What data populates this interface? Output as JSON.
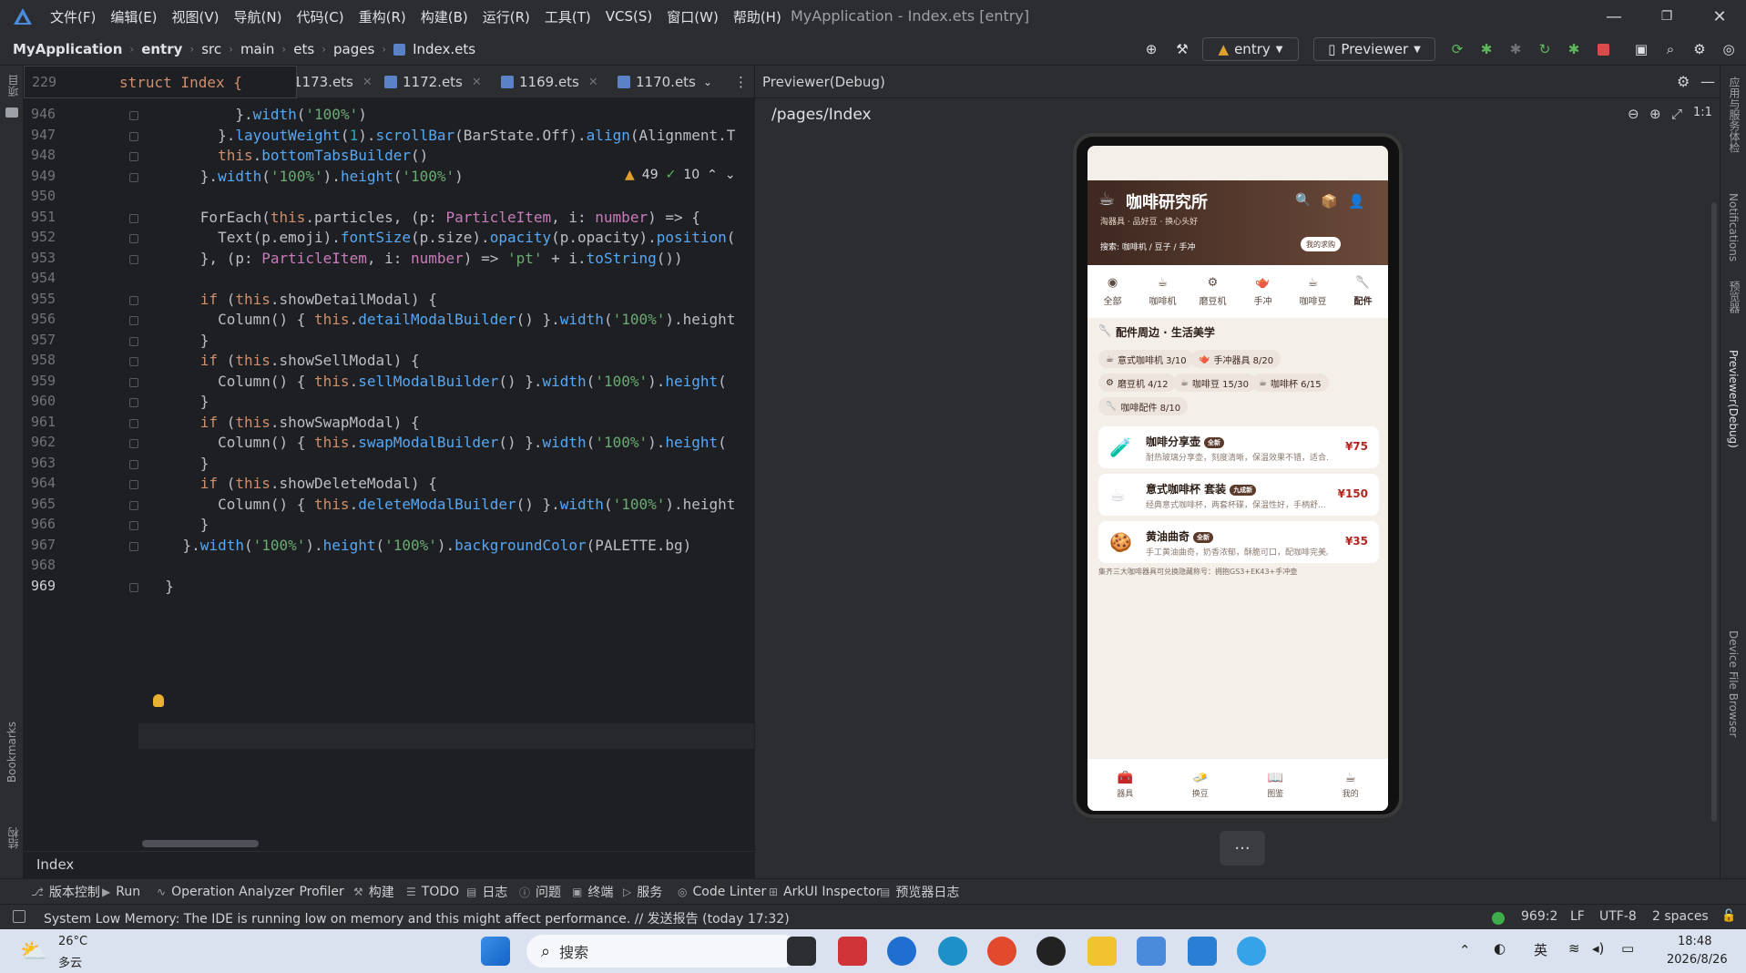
{
  "titlebar": {
    "menu": [
      "文件(F)",
      "编辑(E)",
      "视图(V)",
      "导航(N)",
      "代码(C)",
      "重构(R)",
      "构建(B)",
      "运行(R)",
      "工具(T)",
      "VCS(S)",
      "窗口(W)",
      "帮助(H)"
    ],
    "window_title": "MyApplication - Index.ets [entry]"
  },
  "nav": {
    "breadcrumbs": [
      "MyApplication",
      "entry",
      "src",
      "main",
      "ets",
      "pages",
      "Index.ets"
    ],
    "module": "entry",
    "device": "Previewer"
  },
  "editor": {
    "sticky_line": "229",
    "sticky_code": "struct Index {",
    "tabs": [
      "1173.ets",
      "1172.ets",
      "1169.ets",
      "1170.ets"
    ],
    "warnings": "49",
    "checks": "10",
    "lines": [
      {
        "n": "946",
        "code": "          }.width('100%')"
      },
      {
        "n": "947",
        "code": "        }.layoutWeight(1).scrollBar(BarState.Off).align(Alignment.T"
      },
      {
        "n": "948",
        "code": "        this.bottomTabsBuilder()"
      },
      {
        "n": "949",
        "code": "      }.width('100%').height('100%')"
      },
      {
        "n": "950",
        "code": ""
      },
      {
        "n": "951",
        "code": "      ForEach(this.particles, (p: ParticleItem, i: number) => {"
      },
      {
        "n": "952",
        "code": "        Text(p.emoji).fontSize(p.size).opacity(p.opacity).position("
      },
      {
        "n": "953",
        "code": "      }, (p: ParticleItem, i: number) => 'pt' + i.toString())"
      },
      {
        "n": "954",
        "code": ""
      },
      {
        "n": "955",
        "code": "      if (this.showDetailModal) {"
      },
      {
        "n": "956",
        "code": "        Column() { this.detailModalBuilder() }.width('100%').height"
      },
      {
        "n": "957",
        "code": "      }"
      },
      {
        "n": "958",
        "code": "      if (this.showSellModal) {"
      },
      {
        "n": "959",
        "code": "        Column() { this.sellModalBuilder() }.width('100%').height("
      },
      {
        "n": "960",
        "code": "      }"
      },
      {
        "n": "961",
        "code": "      if (this.showSwapModal) {"
      },
      {
        "n": "962",
        "code": "        Column() { this.swapModalBuilder() }.width('100%').height("
      },
      {
        "n": "963",
        "code": "      }"
      },
      {
        "n": "964",
        "code": "      if (this.showDeleteModal) {"
      },
      {
        "n": "965",
        "code": "        Column() { this.deleteModalBuilder() }.width('100%').height"
      },
      {
        "n": "966",
        "code": "      }"
      },
      {
        "n": "967",
        "code": "    }.width('100%').height('100%').backgroundColor(PALETTE.bg)"
      },
      {
        "n": "968",
        "code": ""
      },
      {
        "n": "969",
        "code": "  }"
      }
    ],
    "footer": "Index"
  },
  "preview": {
    "title": "Previewer(Debug)",
    "path": "/pages/Index",
    "app": {
      "title": "咖啡研究所",
      "subtitle": "淘器具 · 品好豆 · 换心头好",
      "search": "搜索: 咖啡机 / 豆子 / 手冲",
      "wish_button": "我的求购",
      "categories": [
        "全部",
        "咖啡机",
        "磨豆机",
        "手冲",
        "咖啡豆",
        "配件"
      ],
      "category_icons": [
        "◉",
        "☕",
        "⚙",
        "🫖",
        "☕",
        "🥄"
      ],
      "section_title": "配件周边 · 生活美学",
      "chips": [
        {
          "label": "意式咖啡机 3/10"
        },
        {
          "label": "手冲器具 8/20"
        },
        {
          "label": "磨豆机 4/12"
        },
        {
          "label": "咖啡豆 15/30"
        },
        {
          "label": "咖啡杯 6/15"
        },
        {
          "label": "咖啡配件 8/10"
        }
      ],
      "items": [
        {
          "title": "咖啡分享壶",
          "badge": "全新",
          "desc": "耐热玻璃分享壶，刻度清晰，保温效果不错，适合...",
          "price": "¥75",
          "icon": "🧪"
        },
        {
          "title": "意式咖啡杯 套装",
          "badge": "九成新",
          "desc": "经典意式咖啡杯，两套杯碟，保温性好，手柄舒...",
          "price": "¥150",
          "icon": "☕"
        },
        {
          "title": "黄油曲奇",
          "badge": "全新",
          "desc": "手工黄油曲奇，奶香浓郁，酥脆可口，配咖啡完美。",
          "price": "¥35",
          "icon": "🍪"
        }
      ],
      "tip": "集齐三大咖啡器具可兑换隐藏称号：拥抱GS3+EK43+手冲壶",
      "bottom_nav": [
        {
          "label": "器具",
          "icon": "🧰"
        },
        {
          "label": "换豆",
          "icon": "🧈"
        },
        {
          "label": "图鉴",
          "icon": "📖"
        },
        {
          "label": "我的",
          "icon": "☕"
        }
      ]
    }
  },
  "toolwindows": [
    "版本控制",
    "Run",
    "Operation Analyzer",
    "Profiler",
    "构建",
    "TODO",
    "日志",
    "问题",
    "终端",
    "服务",
    "Code Linter",
    "ArkUI Inspector",
    "预览器日志"
  ],
  "status": {
    "message": "System Low Memory: The IDE is running low on memory and this might affect performance. // 发送报告 (today 17:32)",
    "position": "969:2",
    "line_sep": "LF",
    "encoding": "UTF-8",
    "indent": "2 spaces"
  },
  "taskbar": {
    "weather_temp": "26°C",
    "weather_desc": "多云",
    "search_placeholder": "搜索",
    "lang": "英",
    "time": "18:48",
    "date": "2026/8/26"
  },
  "right_strip": [
    "应用与服务体检",
    "Notifications",
    "预览器",
    "Previewer(Debug)",
    "Device File Browser"
  ],
  "left_strip": [
    "项目",
    "Bookmarks",
    "结构"
  ]
}
